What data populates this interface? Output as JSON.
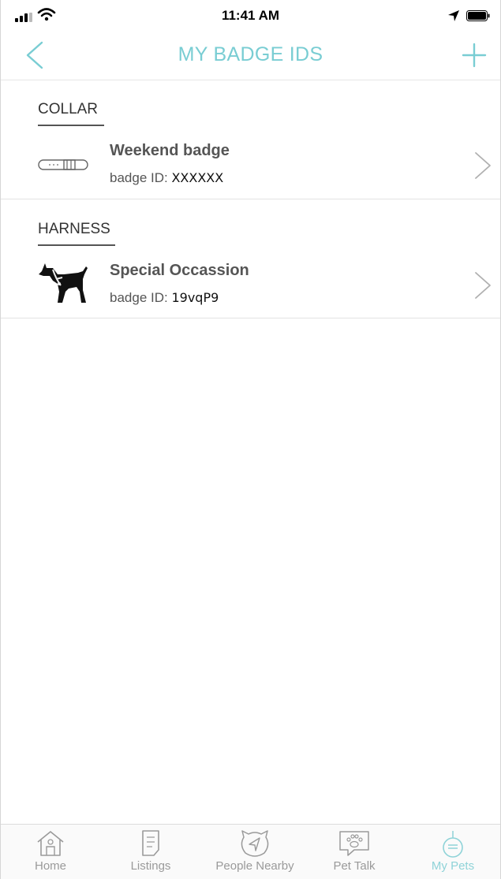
{
  "status_bar": {
    "time": "11:41 AM"
  },
  "nav": {
    "title": "MY BADGE IDS",
    "accent_color": "#79cdd3"
  },
  "sections": [
    {
      "header": "COLLAR",
      "item": {
        "title": "Weekend badge",
        "id_label": "badge ID: ",
        "id_value": "XXXXXX",
        "icon": "collar-icon"
      }
    },
    {
      "header": "HARNESS",
      "item": {
        "title": "Special Occassion",
        "id_label": "badge ID: ",
        "id_value": "19vqP9",
        "icon": "dog-harness-icon"
      }
    }
  ],
  "tabs": [
    {
      "label": "Home",
      "icon": "home-icon",
      "active": false
    },
    {
      "label": "Listings",
      "icon": "listings-icon",
      "active": false
    },
    {
      "label": "People Nearby",
      "icon": "people-nearby-icon",
      "active": false
    },
    {
      "label": "Pet Talk",
      "icon": "pet-talk-icon",
      "active": false
    },
    {
      "label": "My Pets",
      "icon": "my-pets-icon",
      "active": true
    }
  ]
}
